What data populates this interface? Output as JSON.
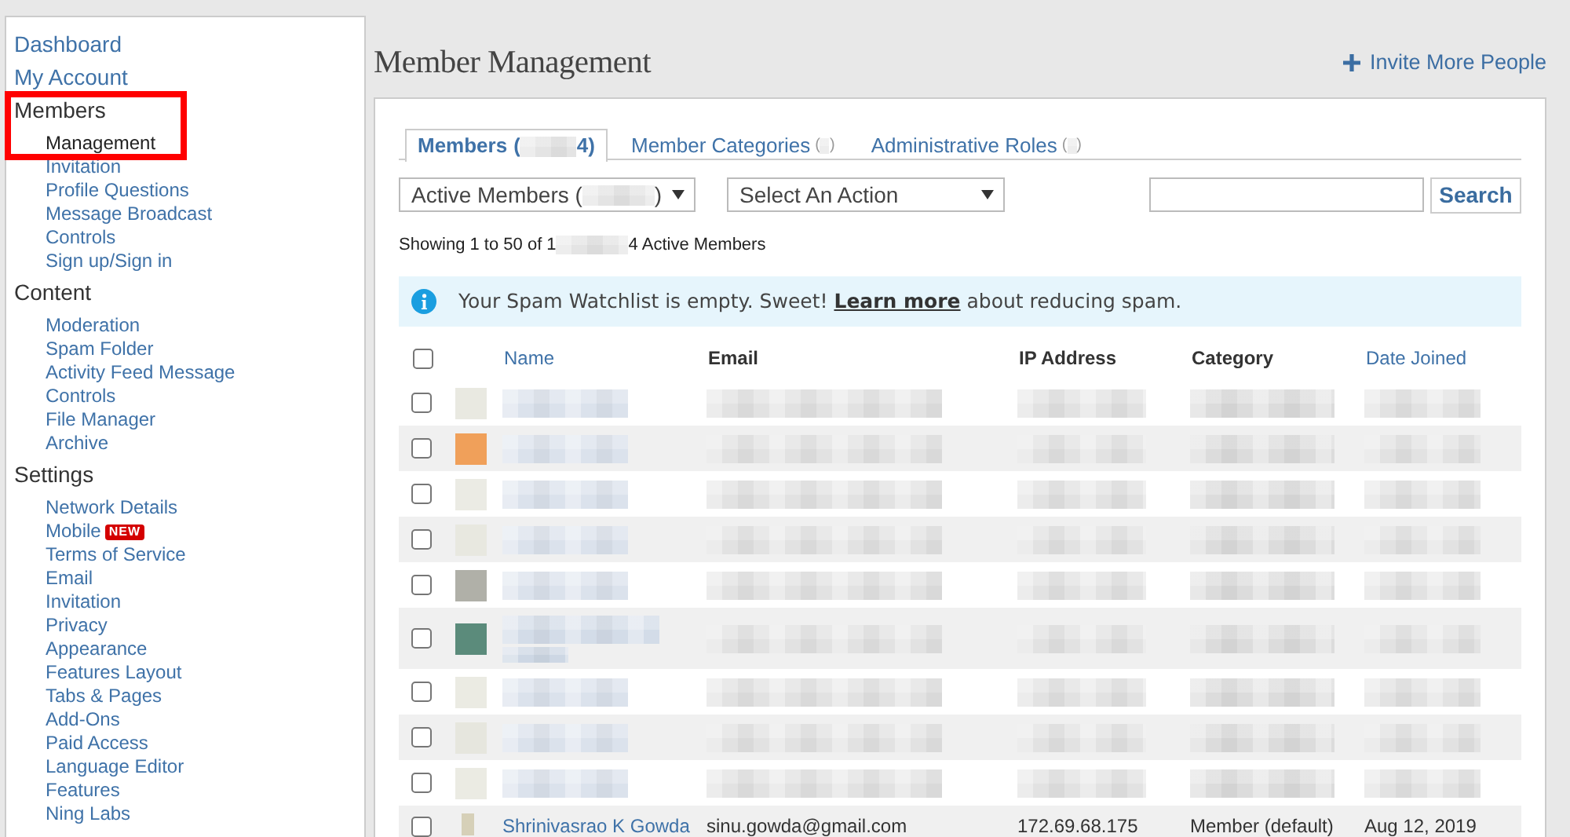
{
  "sidebar": {
    "items": [
      {
        "label": "Dashboard",
        "kind": "link",
        "selected": false
      },
      {
        "label": "My Account",
        "kind": "link",
        "selected": false
      },
      {
        "label": "Members",
        "kind": "section",
        "selected": false,
        "highlighted": true,
        "children": [
          {
            "label": "Management",
            "selected": true
          },
          {
            "label": "Invitation",
            "selected": false
          },
          {
            "label": "Profile Questions",
            "selected": false
          },
          {
            "label": "Message Broadcast",
            "selected": false
          },
          {
            "label": "Controls",
            "selected": false
          },
          {
            "label": "Sign up/Sign in",
            "selected": false
          }
        ]
      },
      {
        "label": "Content",
        "kind": "section",
        "selected": false,
        "highlighted": false,
        "children": [
          {
            "label": "Moderation",
            "selected": false
          },
          {
            "label": "Spam Folder",
            "selected": false
          },
          {
            "label": "Activity Feed Message",
            "selected": false
          },
          {
            "label": "Controls",
            "selected": false
          },
          {
            "label": "File Manager",
            "selected": false
          },
          {
            "label": "Archive",
            "selected": false
          }
        ]
      },
      {
        "label": "Settings",
        "kind": "section",
        "selected": false,
        "highlighted": false,
        "children": [
          {
            "label": "Network Details",
            "selected": false
          },
          {
            "label": "Mobile",
            "selected": false,
            "badge": "NEW"
          },
          {
            "label": "Terms of Service",
            "selected": false
          },
          {
            "label": "Email",
            "selected": false
          },
          {
            "label": "Invitation",
            "selected": false
          },
          {
            "label": "Privacy",
            "selected": false
          },
          {
            "label": "Appearance",
            "selected": false
          },
          {
            "label": "Features Layout",
            "selected": false
          },
          {
            "label": "Tabs & Pages",
            "selected": false
          },
          {
            "label": "Add-Ons",
            "selected": false
          },
          {
            "label": "Paid Access",
            "selected": false
          },
          {
            "label": "Language Editor",
            "selected": false
          },
          {
            "label": "Features",
            "selected": false
          },
          {
            "label": "Ning Labs",
            "selected": false
          }
        ]
      }
    ]
  },
  "page": {
    "title": "Member Management",
    "invite_link": "Invite More People"
  },
  "tabs": [
    {
      "label": "Members",
      "count_prefix": "(",
      "count_suffix": "4)",
      "selected": true
    },
    {
      "label": "Member Categories",
      "count_prefix": "(",
      "count_suffix": ")",
      "selected": false
    },
    {
      "label": "Administrative Roles",
      "count_prefix": "(",
      "count_suffix": ")",
      "selected": false
    }
  ],
  "filters": {
    "status_dropdown": {
      "before": "Active Members (",
      "after": ")"
    },
    "action_dropdown": {
      "value": "Select An Action"
    },
    "search_button": "Search"
  },
  "summary": {
    "before": "Showing 1 to 50 of 1",
    "after": "4 Active Members"
  },
  "alert": {
    "message_start": "Your Spam Watchlist is empty. Sweet!",
    "link": "Learn more",
    "message_end": "about reducing spam."
  },
  "table": {
    "select_all": {
      "checked": false
    },
    "columns": [
      {
        "label": "Name",
        "sortable": true
      },
      {
        "label": "Email",
        "sortable": false
      },
      {
        "label": "IP Address",
        "sortable": false
      },
      {
        "label": "Category",
        "sortable": false
      },
      {
        "label": "Date Joined",
        "sortable": true
      }
    ],
    "rows": [
      {
        "kind": "redacted",
        "checked": false,
        "color": "#e9e9e1",
        "wrapped": false
      },
      {
        "kind": "redacted",
        "checked": false,
        "color": "#f0a05a",
        "wrapped": false
      },
      {
        "kind": "redacted",
        "checked": false,
        "color": "#ebebe4",
        "wrapped": false
      },
      {
        "kind": "redacted",
        "checked": false,
        "color": "#e8e8e0",
        "wrapped": false
      },
      {
        "kind": "redacted",
        "checked": false,
        "color": "#b0b0a8",
        "wrapped": false
      },
      {
        "kind": "redacted",
        "checked": false,
        "color": "#5b8b7b",
        "wrapped": true
      },
      {
        "kind": "redacted",
        "checked": false,
        "color": "#ebebe3",
        "wrapped": false
      },
      {
        "kind": "redacted",
        "checked": false,
        "color": "#e6e6de",
        "wrapped": false
      },
      {
        "kind": "redacted",
        "checked": false,
        "color": "#ebebe3",
        "wrapped": false
      },
      {
        "kind": "member",
        "checked": false,
        "color": "#d6d0b8",
        "wrapped": false,
        "cells": [
          "Shrinivasrao K Gowda",
          "sinu.gowda@gmail.com",
          "172.69.68.175",
          "Member (default)",
          "Aug 12, 2019"
        ]
      }
    ]
  }
}
